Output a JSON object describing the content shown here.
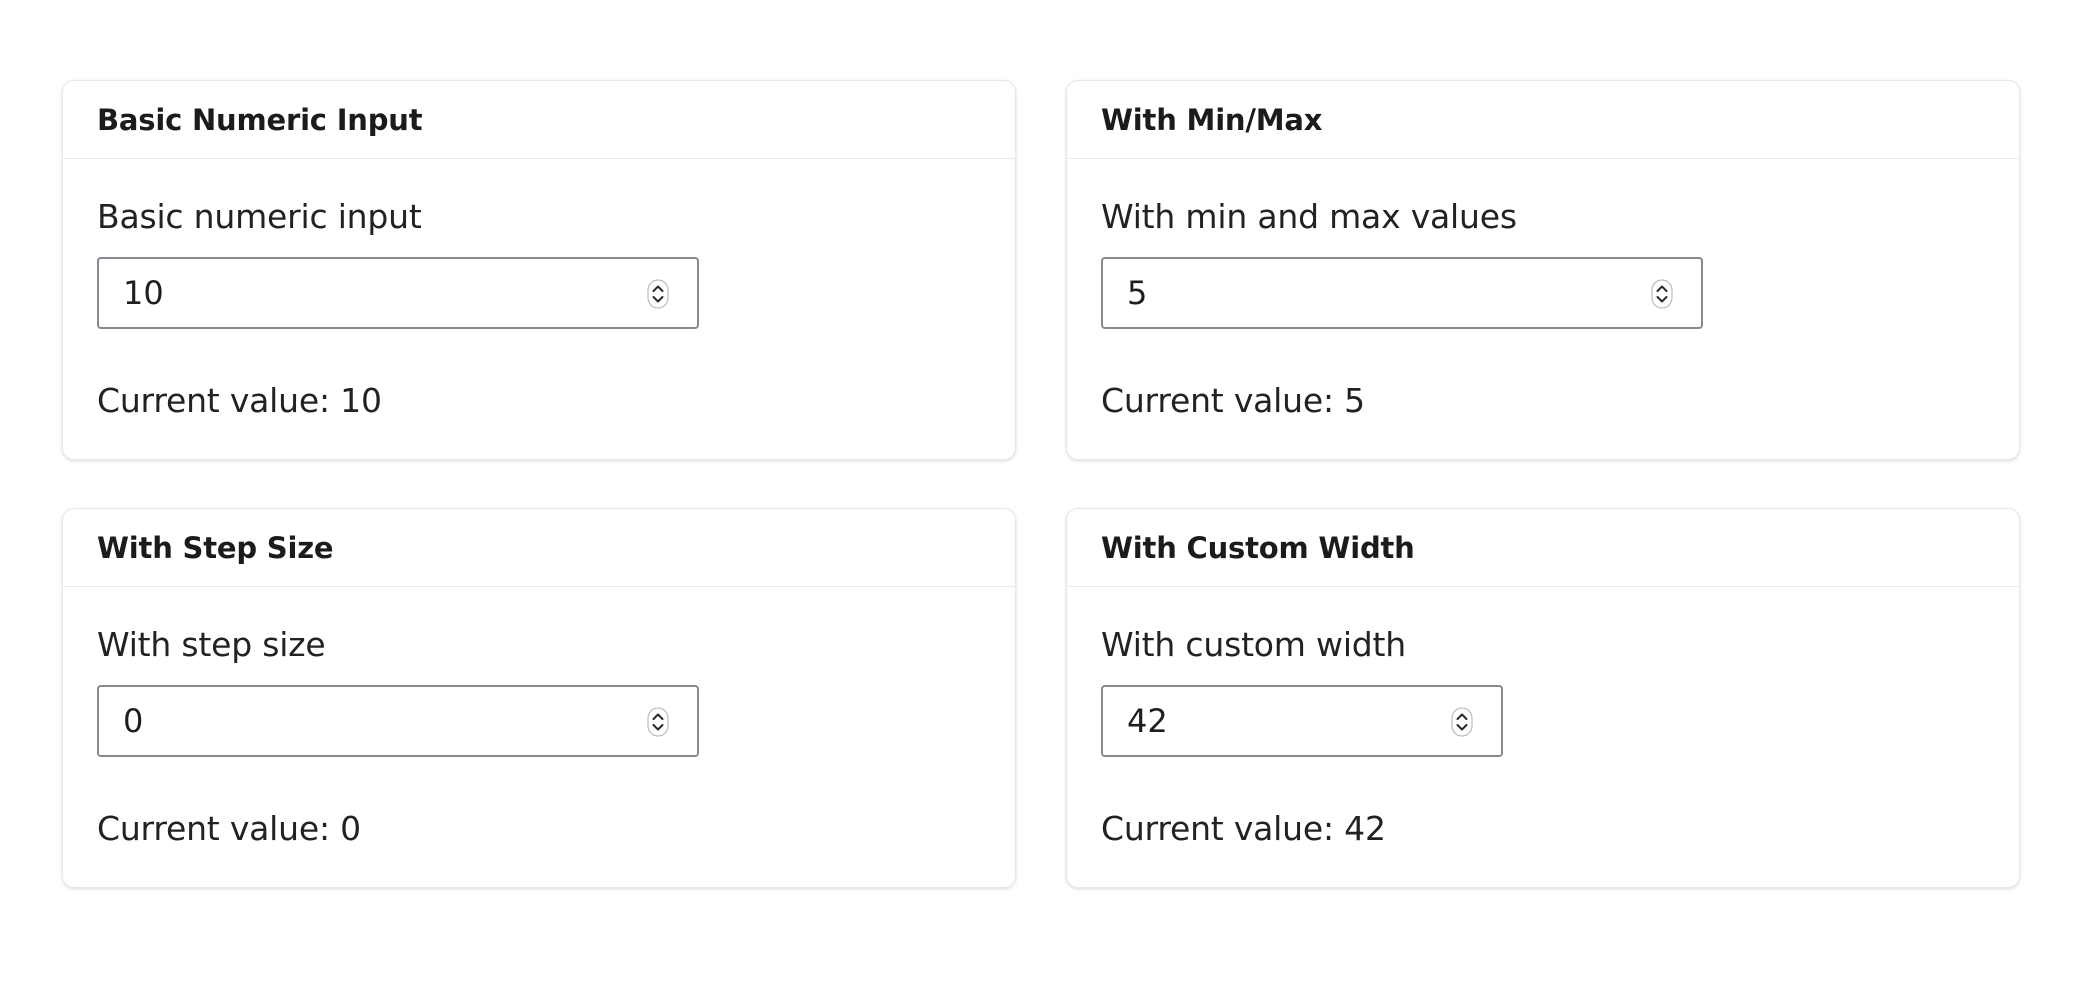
{
  "cards": [
    {
      "title": "Basic Numeric Input",
      "label": "Basic numeric input",
      "value": "10",
      "current_value_text": "Current value: 10"
    },
    {
      "title": "With Min/Max",
      "label": "With min and max values",
      "value": "5",
      "current_value_text": "Current value: 5"
    },
    {
      "title": "With Step Size",
      "label": "With step size",
      "value": "0",
      "current_value_text": "Current value: 0"
    },
    {
      "title": "With Custom Width",
      "label": "With custom width",
      "value": "42",
      "current_value_text": "Current value: 42"
    }
  ],
  "icons": {
    "spinner": "stepper-arrows-icon"
  },
  "colors": {
    "input_border": "#858a91",
    "card_border": "#e8e8e8",
    "text": "#1f1f1f"
  }
}
